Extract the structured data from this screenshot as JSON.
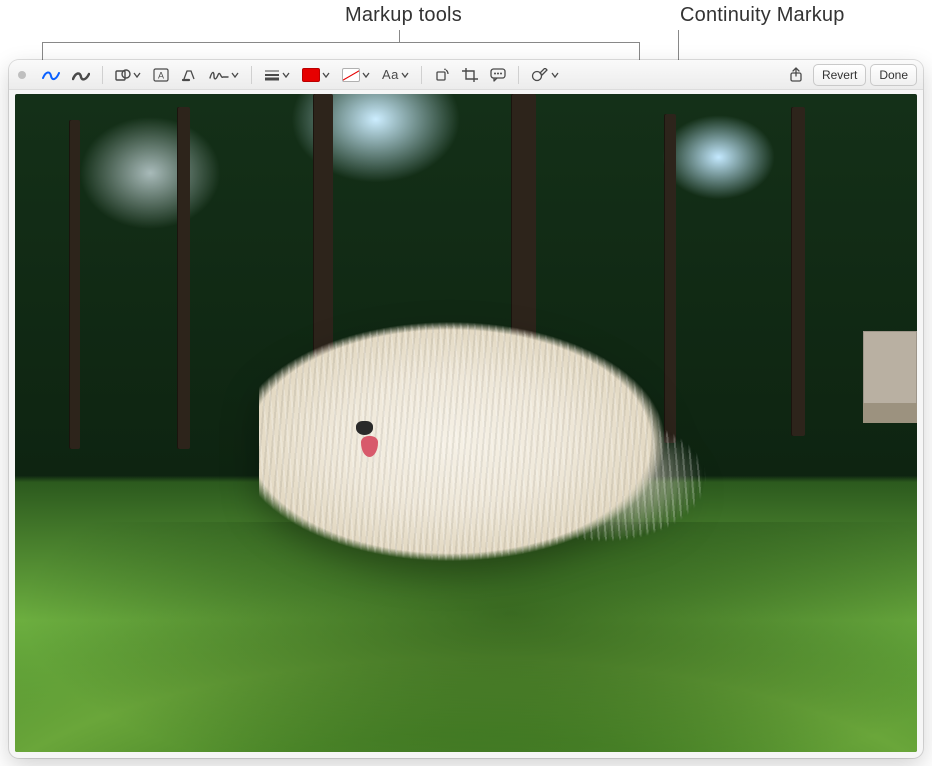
{
  "callouts": {
    "markup_tools": "Markup tools",
    "continuity_markup": "Continuity Markup"
  },
  "toolbar": {
    "sketch": "Sketch",
    "draw": "Draw",
    "shapes": "Shapes",
    "textbox": "Text",
    "highlight": "Highlight",
    "sign": "Sign",
    "shape_style": "Shape Style",
    "border_color": "Border Color",
    "fill_color": "Fill Color",
    "text_style_label": "Aa",
    "text_style": "Text Style",
    "rotate": "Rotate",
    "crop": "Crop",
    "image_description": "Image Description",
    "annotate": "Annotate",
    "share": "Share",
    "revert": "Revert",
    "done": "Done"
  },
  "colors": {
    "accent": "#0a60ff",
    "fill_swatch": "#e60000"
  }
}
